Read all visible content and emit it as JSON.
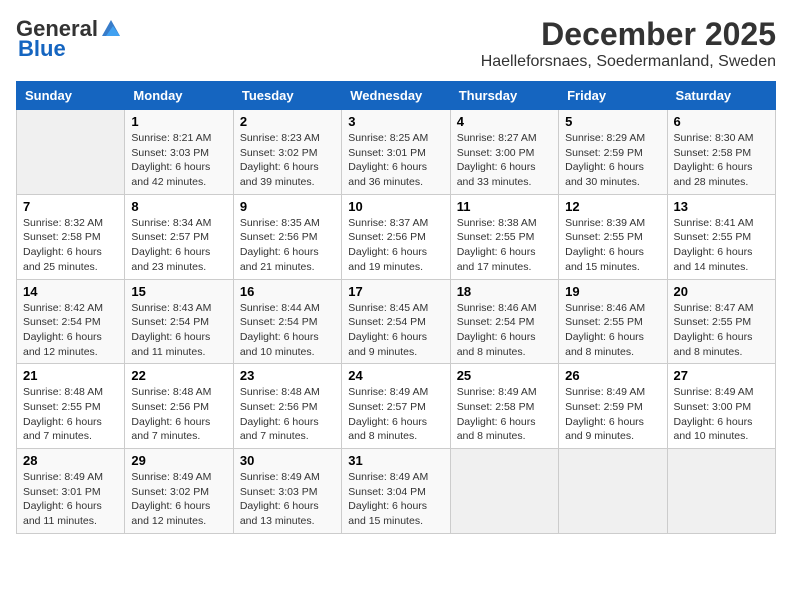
{
  "header": {
    "logo_general": "General",
    "logo_blue": "Blue",
    "month_title": "December 2025",
    "location": "Haelleforsnaes, Soedermanland, Sweden"
  },
  "calendar": {
    "days_of_week": [
      "Sunday",
      "Monday",
      "Tuesday",
      "Wednesday",
      "Thursday",
      "Friday",
      "Saturday"
    ],
    "weeks": [
      [
        {
          "day": "",
          "info": ""
        },
        {
          "day": "1",
          "info": "Sunrise: 8:21 AM\nSunset: 3:03 PM\nDaylight: 6 hours\nand 42 minutes."
        },
        {
          "day": "2",
          "info": "Sunrise: 8:23 AM\nSunset: 3:02 PM\nDaylight: 6 hours\nand 39 minutes."
        },
        {
          "day": "3",
          "info": "Sunrise: 8:25 AM\nSunset: 3:01 PM\nDaylight: 6 hours\nand 36 minutes."
        },
        {
          "day": "4",
          "info": "Sunrise: 8:27 AM\nSunset: 3:00 PM\nDaylight: 6 hours\nand 33 minutes."
        },
        {
          "day": "5",
          "info": "Sunrise: 8:29 AM\nSunset: 2:59 PM\nDaylight: 6 hours\nand 30 minutes."
        },
        {
          "day": "6",
          "info": "Sunrise: 8:30 AM\nSunset: 2:58 PM\nDaylight: 6 hours\nand 28 minutes."
        }
      ],
      [
        {
          "day": "7",
          "info": "Sunrise: 8:32 AM\nSunset: 2:58 PM\nDaylight: 6 hours\nand 25 minutes."
        },
        {
          "day": "8",
          "info": "Sunrise: 8:34 AM\nSunset: 2:57 PM\nDaylight: 6 hours\nand 23 minutes."
        },
        {
          "day": "9",
          "info": "Sunrise: 8:35 AM\nSunset: 2:56 PM\nDaylight: 6 hours\nand 21 minutes."
        },
        {
          "day": "10",
          "info": "Sunrise: 8:37 AM\nSunset: 2:56 PM\nDaylight: 6 hours\nand 19 minutes."
        },
        {
          "day": "11",
          "info": "Sunrise: 8:38 AM\nSunset: 2:55 PM\nDaylight: 6 hours\nand 17 minutes."
        },
        {
          "day": "12",
          "info": "Sunrise: 8:39 AM\nSunset: 2:55 PM\nDaylight: 6 hours\nand 15 minutes."
        },
        {
          "day": "13",
          "info": "Sunrise: 8:41 AM\nSunset: 2:55 PM\nDaylight: 6 hours\nand 14 minutes."
        }
      ],
      [
        {
          "day": "14",
          "info": "Sunrise: 8:42 AM\nSunset: 2:54 PM\nDaylight: 6 hours\nand 12 minutes."
        },
        {
          "day": "15",
          "info": "Sunrise: 8:43 AM\nSunset: 2:54 PM\nDaylight: 6 hours\nand 11 minutes."
        },
        {
          "day": "16",
          "info": "Sunrise: 8:44 AM\nSunset: 2:54 PM\nDaylight: 6 hours\nand 10 minutes."
        },
        {
          "day": "17",
          "info": "Sunrise: 8:45 AM\nSunset: 2:54 PM\nDaylight: 6 hours\nand 9 minutes."
        },
        {
          "day": "18",
          "info": "Sunrise: 8:46 AM\nSunset: 2:54 PM\nDaylight: 6 hours\nand 8 minutes."
        },
        {
          "day": "19",
          "info": "Sunrise: 8:46 AM\nSunset: 2:55 PM\nDaylight: 6 hours\nand 8 minutes."
        },
        {
          "day": "20",
          "info": "Sunrise: 8:47 AM\nSunset: 2:55 PM\nDaylight: 6 hours\nand 8 minutes."
        }
      ],
      [
        {
          "day": "21",
          "info": "Sunrise: 8:48 AM\nSunset: 2:55 PM\nDaylight: 6 hours\nand 7 minutes."
        },
        {
          "day": "22",
          "info": "Sunrise: 8:48 AM\nSunset: 2:56 PM\nDaylight: 6 hours\nand 7 minutes."
        },
        {
          "day": "23",
          "info": "Sunrise: 8:48 AM\nSunset: 2:56 PM\nDaylight: 6 hours\nand 7 minutes."
        },
        {
          "day": "24",
          "info": "Sunrise: 8:49 AM\nSunset: 2:57 PM\nDaylight: 6 hours\nand 8 minutes."
        },
        {
          "day": "25",
          "info": "Sunrise: 8:49 AM\nSunset: 2:58 PM\nDaylight: 6 hours\nand 8 minutes."
        },
        {
          "day": "26",
          "info": "Sunrise: 8:49 AM\nSunset: 2:59 PM\nDaylight: 6 hours\nand 9 minutes."
        },
        {
          "day": "27",
          "info": "Sunrise: 8:49 AM\nSunset: 3:00 PM\nDaylight: 6 hours\nand 10 minutes."
        }
      ],
      [
        {
          "day": "28",
          "info": "Sunrise: 8:49 AM\nSunset: 3:01 PM\nDaylight: 6 hours\nand 11 minutes."
        },
        {
          "day": "29",
          "info": "Sunrise: 8:49 AM\nSunset: 3:02 PM\nDaylight: 6 hours\nand 12 minutes."
        },
        {
          "day": "30",
          "info": "Sunrise: 8:49 AM\nSunset: 3:03 PM\nDaylight: 6 hours\nand 13 minutes."
        },
        {
          "day": "31",
          "info": "Sunrise: 8:49 AM\nSunset: 3:04 PM\nDaylight: 6 hours\nand 15 minutes."
        },
        {
          "day": "",
          "info": ""
        },
        {
          "day": "",
          "info": ""
        },
        {
          "day": "",
          "info": ""
        }
      ]
    ]
  }
}
